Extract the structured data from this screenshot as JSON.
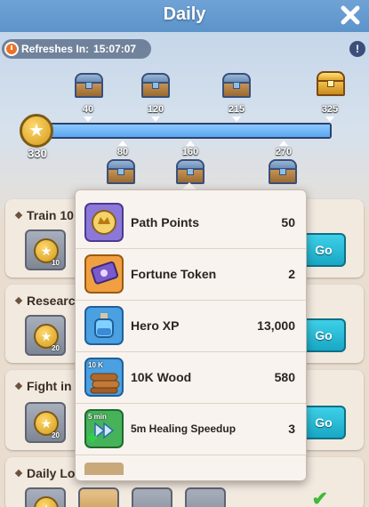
{
  "header": {
    "title": "Daily"
  },
  "refresh": {
    "label": "Refreshes In:",
    "time": "15:07:07"
  },
  "progress": {
    "points": "330",
    "fraction": 1.0,
    "milestones_top": [
      "40",
      "120",
      "215",
      "325"
    ],
    "milestones_bottom": [
      "80",
      "160",
      "270"
    ]
  },
  "tasks": [
    {
      "title": "Train 10",
      "reward_qty": "10",
      "button_label": "Go"
    },
    {
      "title": "Researc",
      "reward_qty": "20",
      "button_label": "Go"
    },
    {
      "title": "Fight in",
      "reward_qty": "20",
      "button_label": "Go"
    },
    {
      "title": "Daily Lo",
      "reward_qty": "",
      "button_label": ""
    }
  ],
  "tooltip": {
    "items": [
      {
        "name": "Path Points",
        "qty": "50",
        "icon": "path-points-icon",
        "badge": ""
      },
      {
        "name": "Fortune Token",
        "qty": "2",
        "icon": "fortune-token-icon",
        "badge": ""
      },
      {
        "name": "Hero XP",
        "qty": "13,000",
        "icon": "hero-xp-potion-icon",
        "badge": ""
      },
      {
        "name": "10K Wood",
        "qty": "580",
        "icon": "wood-icon",
        "badge": "10 K"
      },
      {
        "name": "5m Healing Speedup",
        "qty": "3",
        "icon": "healing-speedup-icon",
        "badge": "5 min"
      }
    ]
  },
  "colors": {
    "header": "#5c93c9",
    "go_button": "#18a7c4",
    "progress_fill": "#5aa6f0"
  }
}
